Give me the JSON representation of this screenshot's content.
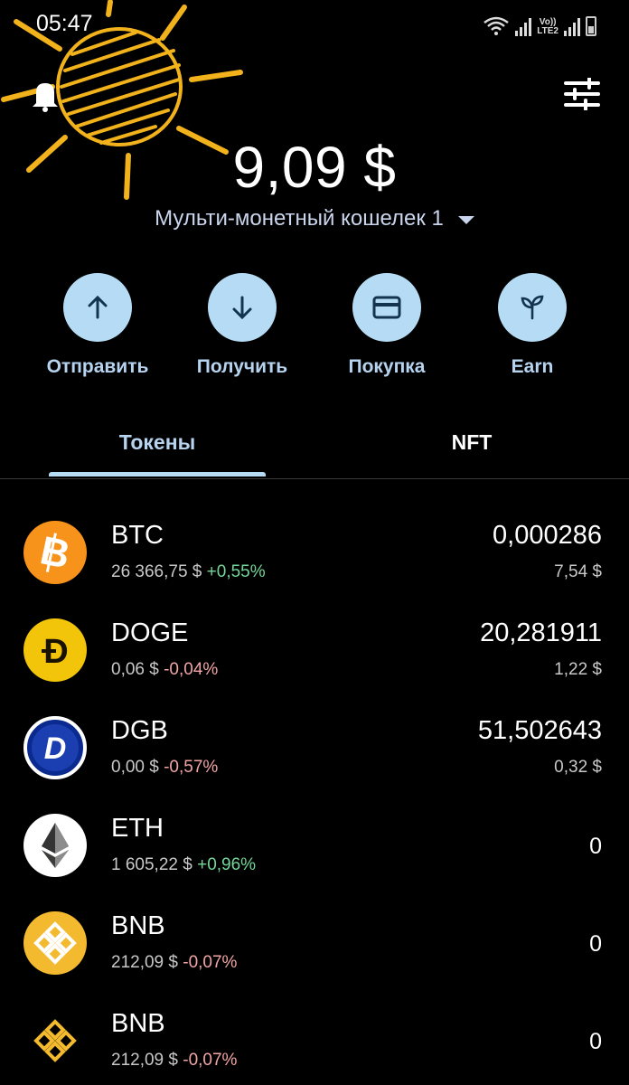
{
  "status_bar": {
    "time": "05:47",
    "network_label_1": "Vo))",
    "network_label_2": "LTE2"
  },
  "header": {
    "balance": "9,09 $",
    "wallet_name": "Мульти-монетный кошелек 1"
  },
  "actions": [
    {
      "label": "Отправить",
      "icon": "arrow-up-icon"
    },
    {
      "label": "Получить",
      "icon": "arrow-down-icon"
    },
    {
      "label": "Покупка",
      "icon": "card-icon"
    },
    {
      "label": "Earn",
      "icon": "sprout-icon"
    }
  ],
  "tabs": {
    "tokens": "Токены",
    "nft": "NFT",
    "active": "tokens"
  },
  "tokens": [
    {
      "symbol": "BTC",
      "price": "26 366,75 $",
      "change": "+0,55%",
      "amount": "0,000286",
      "fiat": "7,54 $",
      "icon": "bitcoin-icon",
      "color": "#f7931a"
    },
    {
      "symbol": "DOGE",
      "price": "0,06 $",
      "change": "-0,04%",
      "amount": "20,281911",
      "fiat": "1,22 $",
      "icon": "dogecoin-icon",
      "color": "#f2c40a"
    },
    {
      "symbol": "DGB",
      "price": "0,00 $",
      "change": "-0,57%",
      "amount": "51,502643",
      "fiat": "0,32 $",
      "icon": "digibyte-icon",
      "color": "#0b2a8f"
    },
    {
      "symbol": "ETH",
      "price": "1 605,22 $",
      "change": "+0,96%",
      "amount": "0",
      "fiat": "",
      "icon": "ethereum-icon",
      "color": "#ffffff"
    },
    {
      "symbol": "BNB",
      "price": "212,09 $",
      "change": "-0,07%",
      "amount": "0",
      "fiat": "",
      "icon": "bnb-icon",
      "color": "#f3ba2f"
    },
    {
      "symbol": "BNB",
      "price": "212,09 $",
      "change": "-0,07%",
      "amount": "0",
      "fiat": "",
      "icon": "bnb-icon",
      "color": "#f3ba2f"
    }
  ],
  "colors": {
    "accent": "#b6dcf5",
    "positive": "#73d79a",
    "negative": "#f2a5a5",
    "background": "#000000"
  }
}
